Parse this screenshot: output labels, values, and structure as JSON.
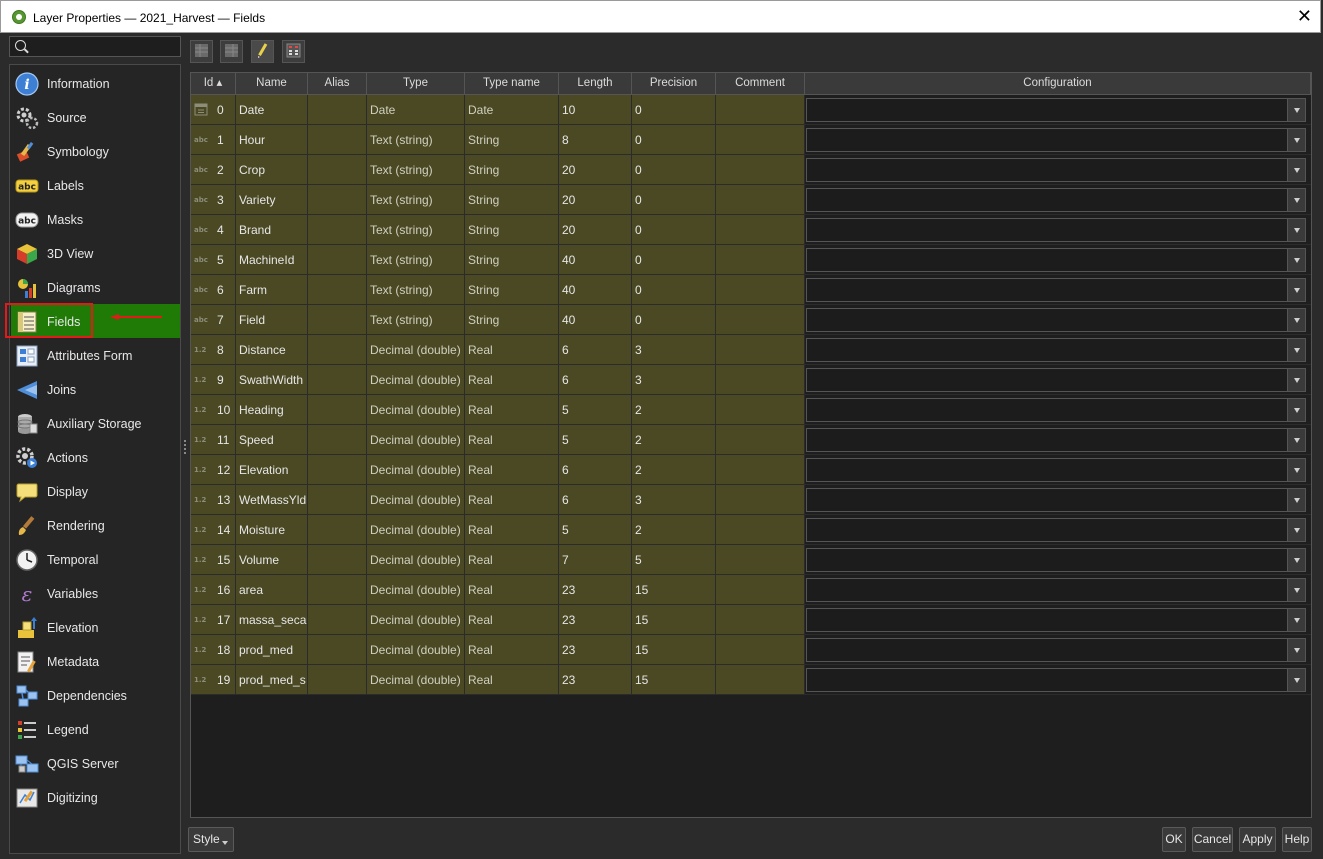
{
  "window": {
    "title": "Layer Properties — 2021_Harvest — Fields",
    "close_label": "✕"
  },
  "search": {
    "placeholder": ""
  },
  "sidebar": {
    "items": [
      {
        "label": "Information",
        "icon": "info-icon"
      },
      {
        "label": "Source",
        "icon": "source-gear-icon"
      },
      {
        "label": "Symbology",
        "icon": "paintbrush-icon"
      },
      {
        "label": "Labels",
        "icon": "abc-label-icon"
      },
      {
        "label": "Masks",
        "icon": "abc-mask-icon"
      },
      {
        "label": "3D View",
        "icon": "cube-icon"
      },
      {
        "label": "Diagrams",
        "icon": "diagram-icon"
      },
      {
        "label": "Fields",
        "icon": "fields-icon",
        "selected": true
      },
      {
        "label": "Attributes Form",
        "icon": "form-icon"
      },
      {
        "label": "Joins",
        "icon": "join-icon"
      },
      {
        "label": "Auxiliary Storage",
        "icon": "database-icon"
      },
      {
        "label": "Actions",
        "icon": "actions-gear-icon"
      },
      {
        "label": "Display",
        "icon": "speech-bubble-icon"
      },
      {
        "label": "Rendering",
        "icon": "brush-icon"
      },
      {
        "label": "Temporal",
        "icon": "clock-icon"
      },
      {
        "label": "Variables",
        "icon": "epsilon-icon"
      },
      {
        "label": "Elevation",
        "icon": "elevation-icon"
      },
      {
        "label": "Metadata",
        "icon": "metadata-icon"
      },
      {
        "label": "Dependencies",
        "icon": "dependencies-icon"
      },
      {
        "label": "Legend",
        "icon": "legend-icon"
      },
      {
        "label": "QGIS Server",
        "icon": "server-icon"
      },
      {
        "label": "Digitizing",
        "icon": "digitizing-icon"
      }
    ]
  },
  "toolbar": {
    "buttons": [
      {
        "name": "new-field-icon"
      },
      {
        "name": "delete-field-icon"
      },
      {
        "name": "toggle-editing-icon"
      },
      {
        "name": "field-calculator-icon"
      }
    ]
  },
  "table": {
    "columns": [
      "Id ▴",
      "Name",
      "Alias",
      "Type",
      "Type name",
      "Length",
      "Precision",
      "Comment",
      "Configuration"
    ],
    "rows": [
      {
        "id": "0",
        "icon": "date",
        "name": "Date",
        "alias": "",
        "type": "Date",
        "type_name": "Date",
        "length": "10",
        "precision": "0",
        "comment": ""
      },
      {
        "id": "1",
        "icon": "abc",
        "name": "Hour",
        "alias": "",
        "type": "Text (string)",
        "type_name": "String",
        "length": "8",
        "precision": "0",
        "comment": ""
      },
      {
        "id": "2",
        "icon": "abc",
        "name": "Crop",
        "alias": "",
        "type": "Text (string)",
        "type_name": "String",
        "length": "20",
        "precision": "0",
        "comment": ""
      },
      {
        "id": "3",
        "icon": "abc",
        "name": "Variety",
        "alias": "",
        "type": "Text (string)",
        "type_name": "String",
        "length": "20",
        "precision": "0",
        "comment": ""
      },
      {
        "id": "4",
        "icon": "abc",
        "name": "Brand",
        "alias": "",
        "type": "Text (string)",
        "type_name": "String",
        "length": "20",
        "precision": "0",
        "comment": ""
      },
      {
        "id": "5",
        "icon": "abc",
        "name": "MachineId",
        "alias": "",
        "type": "Text (string)",
        "type_name": "String",
        "length": "40",
        "precision": "0",
        "comment": ""
      },
      {
        "id": "6",
        "icon": "abc",
        "name": "Farm",
        "alias": "",
        "type": "Text (string)",
        "type_name": "String",
        "length": "40",
        "precision": "0",
        "comment": ""
      },
      {
        "id": "7",
        "icon": "abc",
        "name": "Field",
        "alias": "",
        "type": "Text (string)",
        "type_name": "String",
        "length": "40",
        "precision": "0",
        "comment": ""
      },
      {
        "id": "8",
        "icon": "1.2",
        "name": "Distance",
        "alias": "",
        "type": "Decimal (double)",
        "type_name": "Real",
        "length": "6",
        "precision": "3",
        "comment": ""
      },
      {
        "id": "9",
        "icon": "1.2",
        "name": "SwathWidth",
        "alias": "",
        "type": "Decimal (double)",
        "type_name": "Real",
        "length": "6",
        "precision": "3",
        "comment": ""
      },
      {
        "id": "10",
        "icon": "1.2",
        "name": "Heading",
        "alias": "",
        "type": "Decimal (double)",
        "type_name": "Real",
        "length": "5",
        "precision": "2",
        "comment": ""
      },
      {
        "id": "11",
        "icon": "1.2",
        "name": "Speed",
        "alias": "",
        "type": "Decimal (double)",
        "type_name": "Real",
        "length": "5",
        "precision": "2",
        "comment": ""
      },
      {
        "id": "12",
        "icon": "1.2",
        "name": "Elevation",
        "alias": "",
        "type": "Decimal (double)",
        "type_name": "Real",
        "length": "6",
        "precision": "2",
        "comment": ""
      },
      {
        "id": "13",
        "icon": "1.2",
        "name": "WetMassYld",
        "alias": "",
        "type": "Decimal (double)",
        "type_name": "Real",
        "length": "6",
        "precision": "3",
        "comment": ""
      },
      {
        "id": "14",
        "icon": "1.2",
        "name": "Moisture",
        "alias": "",
        "type": "Decimal (double)",
        "type_name": "Real",
        "length": "5",
        "precision": "2",
        "comment": ""
      },
      {
        "id": "15",
        "icon": "1.2",
        "name": "Volume",
        "alias": "",
        "type": "Decimal (double)",
        "type_name": "Real",
        "length": "7",
        "precision": "5",
        "comment": ""
      },
      {
        "id": "16",
        "icon": "1.2",
        "name": "area",
        "alias": "",
        "type": "Decimal (double)",
        "type_name": "Real",
        "length": "23",
        "precision": "15",
        "comment": ""
      },
      {
        "id": "17",
        "icon": "1.2",
        "name": "massa_seca",
        "alias": "",
        "type": "Decimal (double)",
        "type_name": "Real",
        "length": "23",
        "precision": "15",
        "comment": ""
      },
      {
        "id": "18",
        "icon": "1.2",
        "name": "prod_med",
        "alias": "",
        "type": "Decimal (double)",
        "type_name": "Real",
        "length": "23",
        "precision": "15",
        "comment": ""
      },
      {
        "id": "19",
        "icon": "1.2",
        "name": "prod_med_s",
        "alias": "",
        "type": "Decimal (double)",
        "type_name": "Real",
        "length": "23",
        "precision": "15",
        "comment": ""
      }
    ]
  },
  "footer": {
    "style_label": "Style",
    "ok_label": "OK",
    "cancel_label": "Cancel",
    "apply_label": "Apply",
    "help_label": "Help"
  },
  "colors": {
    "selected_nav": "#1f7a06",
    "editable_row": "#4b4924",
    "highlight_box": "#e21a1a"
  }
}
